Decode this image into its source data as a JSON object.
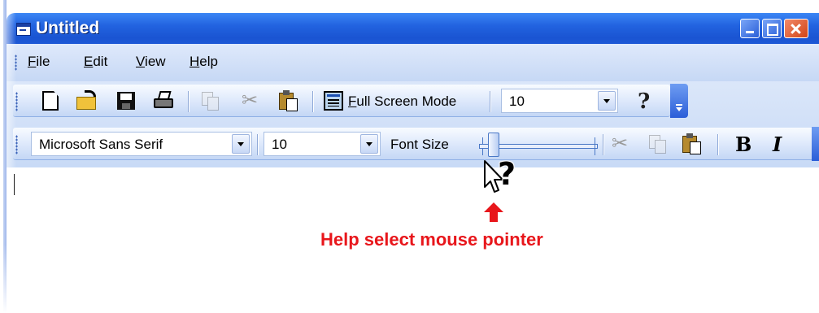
{
  "window": {
    "title": "Untitled",
    "accent": "#2263e0"
  },
  "menu": {
    "items": [
      {
        "label": "File",
        "mnemonic": "F",
        "rest": "ile"
      },
      {
        "label": "Edit",
        "mnemonic": "E",
        "rest": "dit"
      },
      {
        "label": "View",
        "mnemonic": "V",
        "rest": "iew"
      },
      {
        "label": "Help",
        "mnemonic": "H",
        "rest": "elp"
      }
    ]
  },
  "toolbar": {
    "full_screen_mnemonic": "F",
    "full_screen_rest": "ull Screen Mode",
    "zoom_value": "10",
    "icons": [
      "new-icon",
      "open-icon",
      "save-icon",
      "print-icon",
      "copy-icon",
      "cut-icon",
      "paste-icon",
      "full-screen-icon",
      "help-icon"
    ]
  },
  "format_bar": {
    "font_name": "Microsoft Sans Serif",
    "font_size": "10",
    "font_size_label": "Font Size",
    "bold": "B",
    "italic": "I",
    "slider_level": 0.1
  },
  "cursor": {
    "glyph": "?"
  },
  "annotation": {
    "caption": "Help select mouse pointer",
    "color": "#e8161b"
  }
}
